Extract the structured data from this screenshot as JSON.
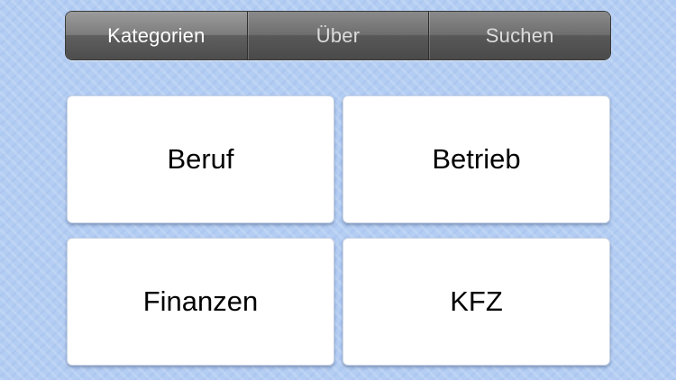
{
  "segmented_control": {
    "tabs": [
      {
        "label": "Kategorien",
        "selected": true
      },
      {
        "label": "Über",
        "selected": false
      },
      {
        "label": "Suchen",
        "selected": false
      }
    ]
  },
  "categories": [
    {
      "label": "Beruf"
    },
    {
      "label": "Betrieb"
    },
    {
      "label": "Finanzen"
    },
    {
      "label": "KFZ"
    }
  ],
  "colors": {
    "background": "#b3cdf3",
    "segment_active": "#6e6e6e",
    "segment_inactive": "#5c5c5c",
    "tile": "#ffffff"
  }
}
